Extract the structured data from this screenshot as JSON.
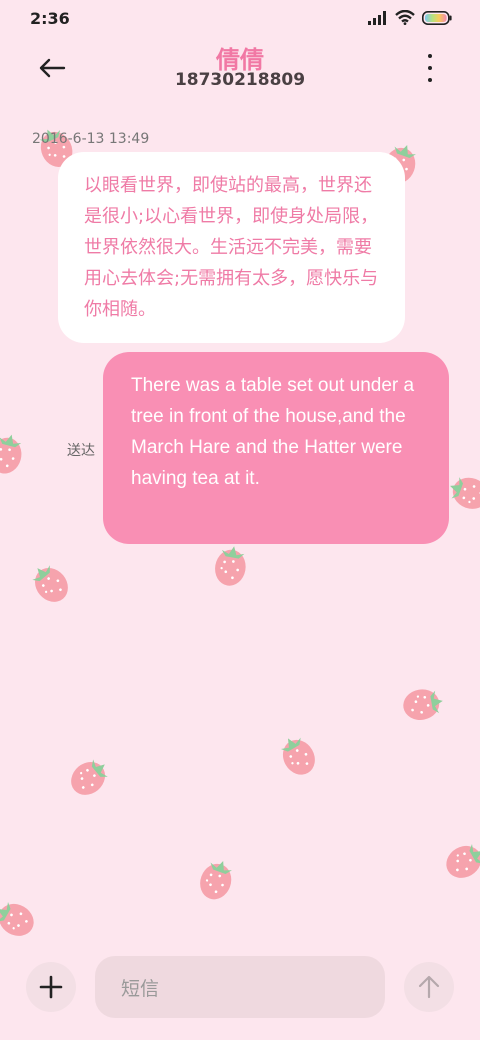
{
  "status_bar": {
    "time": "2:36",
    "icons": [
      "signal-icon",
      "wifi-icon",
      "battery-icon"
    ]
  },
  "header": {
    "contact_name": "倩倩",
    "contact_number": "18730218809",
    "back_icon": "arrow-left-icon",
    "more_icon": "more-vertical-icon"
  },
  "conversation": {
    "timestamp": "2016-6-13 13:49",
    "messages": [
      {
        "direction": "incoming",
        "text": "以眼看世界，即使站的最高，世界还是很小;以心看世界，即使身处局限，世界依然很大。生活远不完美，需要用心去体会;无需拥有太多，愿快乐与你相随。"
      },
      {
        "direction": "outgoing",
        "text": "There was a table set out under a tree in front of the house,and the March Hare and the Hatter were having tea at it.",
        "status": "送达"
      }
    ]
  },
  "composer": {
    "placeholder": "短信",
    "add_icon": "plus-icon",
    "send_icon": "arrow-up-icon"
  },
  "colors": {
    "background": "#fde6ee",
    "accent": "#f178a4",
    "outgoing_bubble": "#f98fb4",
    "incoming_bubble": "#ffffff"
  },
  "decor_icon": "strawberry-icon"
}
